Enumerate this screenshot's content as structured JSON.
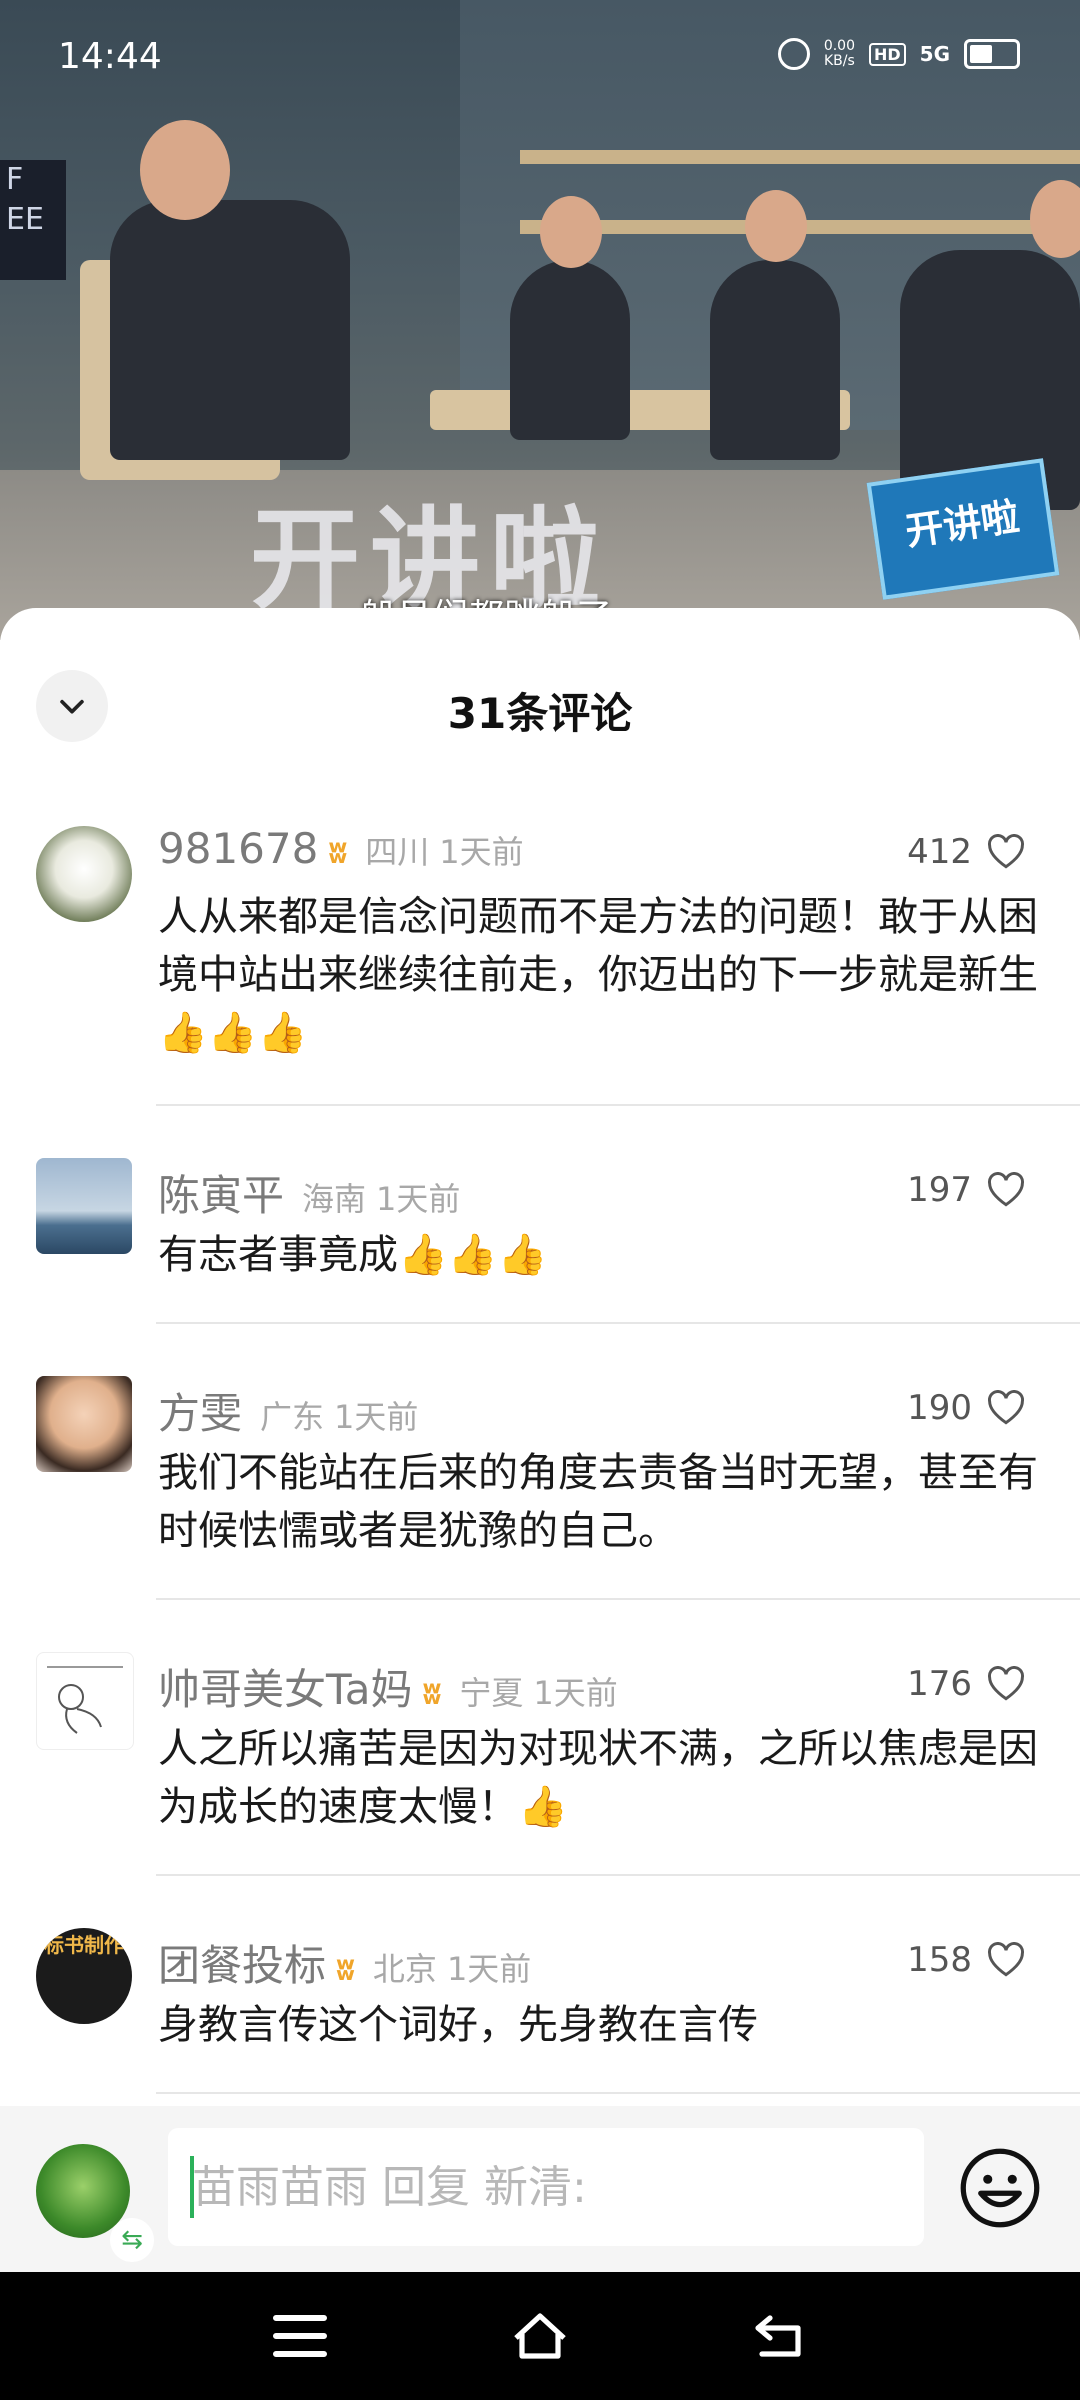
{
  "status_bar": {
    "time": "14:44",
    "net_speed": "0.00",
    "net_unit": "KB/s",
    "hd": "HD",
    "signal": "5G"
  },
  "video": {
    "stage_text": "开讲啦",
    "badge_text": "开讲啦",
    "subtitle": "船员们都跳船了"
  },
  "comments_sheet": {
    "title": "31条评论",
    "comments": [
      {
        "user": "981678",
        "vip": true,
        "location": "四川",
        "time": "1天前",
        "likes": "412",
        "text": "人从来都是信念问题而不是方法的问题！敢于从困境中站出来继续往前走，你迈出的下一步就是新生",
        "thumbs": "👍👍👍"
      },
      {
        "user": "陈寅平",
        "vip": false,
        "location": "海南",
        "time": "1天前",
        "likes": "197",
        "text": "有志者事竟成",
        "thumbs": "👍👍👍"
      },
      {
        "user": "方雯",
        "vip": false,
        "location": "广东",
        "time": "1天前",
        "likes": "190",
        "text": "我们不能站在后来的角度去责备当时无望，甚至有时候怯懦或者是犹豫的自己。",
        "thumbs": ""
      },
      {
        "user": "帅哥美女Ta妈",
        "vip": true,
        "location": "宁夏",
        "time": "1天前",
        "likes": "176",
        "text": "人之所以痛苦是因为对现状不满，之所以焦虑是因为成长的速度太慢！",
        "thumbs": "👍"
      },
      {
        "user": "团餐投标",
        "vip": true,
        "location": "北京",
        "time": "1天前",
        "likes": "158",
        "text": "身教言传这个词好，先身教在言传",
        "thumbs": ""
      }
    ],
    "avatar_texts": {
      "c5": "标书制作"
    }
  },
  "reply_bar": {
    "placeholder": "苗雨苗雨 回复 新清:",
    "swap_symbol": "⇆"
  },
  "colors": {
    "vip": "#f0a52a",
    "caret": "#2bb15a"
  },
  "icons": [
    "chevron-down-icon",
    "heart-icon",
    "emoji-icon",
    "menu-icon",
    "home-icon",
    "back-icon",
    "alarm-icon",
    "battery-icon"
  ]
}
